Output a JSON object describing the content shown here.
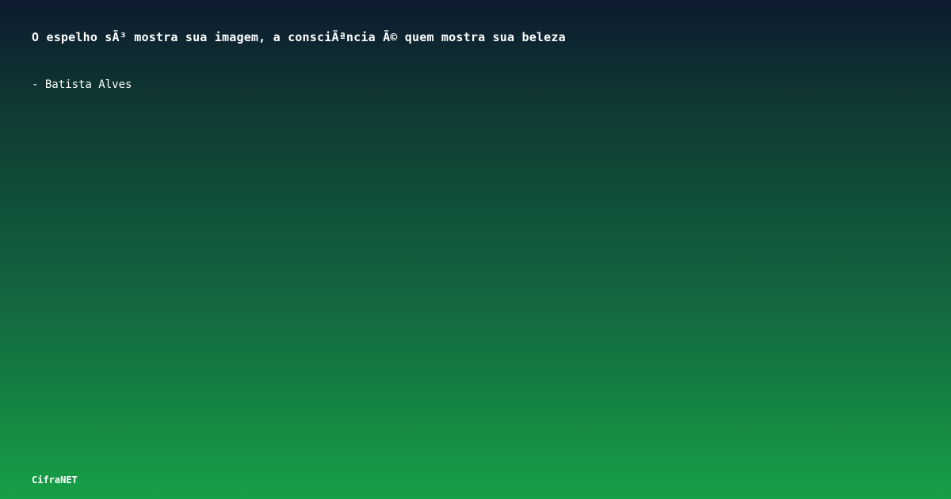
{
  "quote": {
    "text": "O espelho sÃ³ mostra sua imagem, a consciÃªncia Ã© quem mostra sua beleza",
    "author": "- Batista Alves"
  },
  "brand": {
    "name": "CifraNET"
  },
  "colors": {
    "gradient_top": "#0d1a2e",
    "gradient_bottom": "#16a046",
    "text": "#ffffff"
  }
}
